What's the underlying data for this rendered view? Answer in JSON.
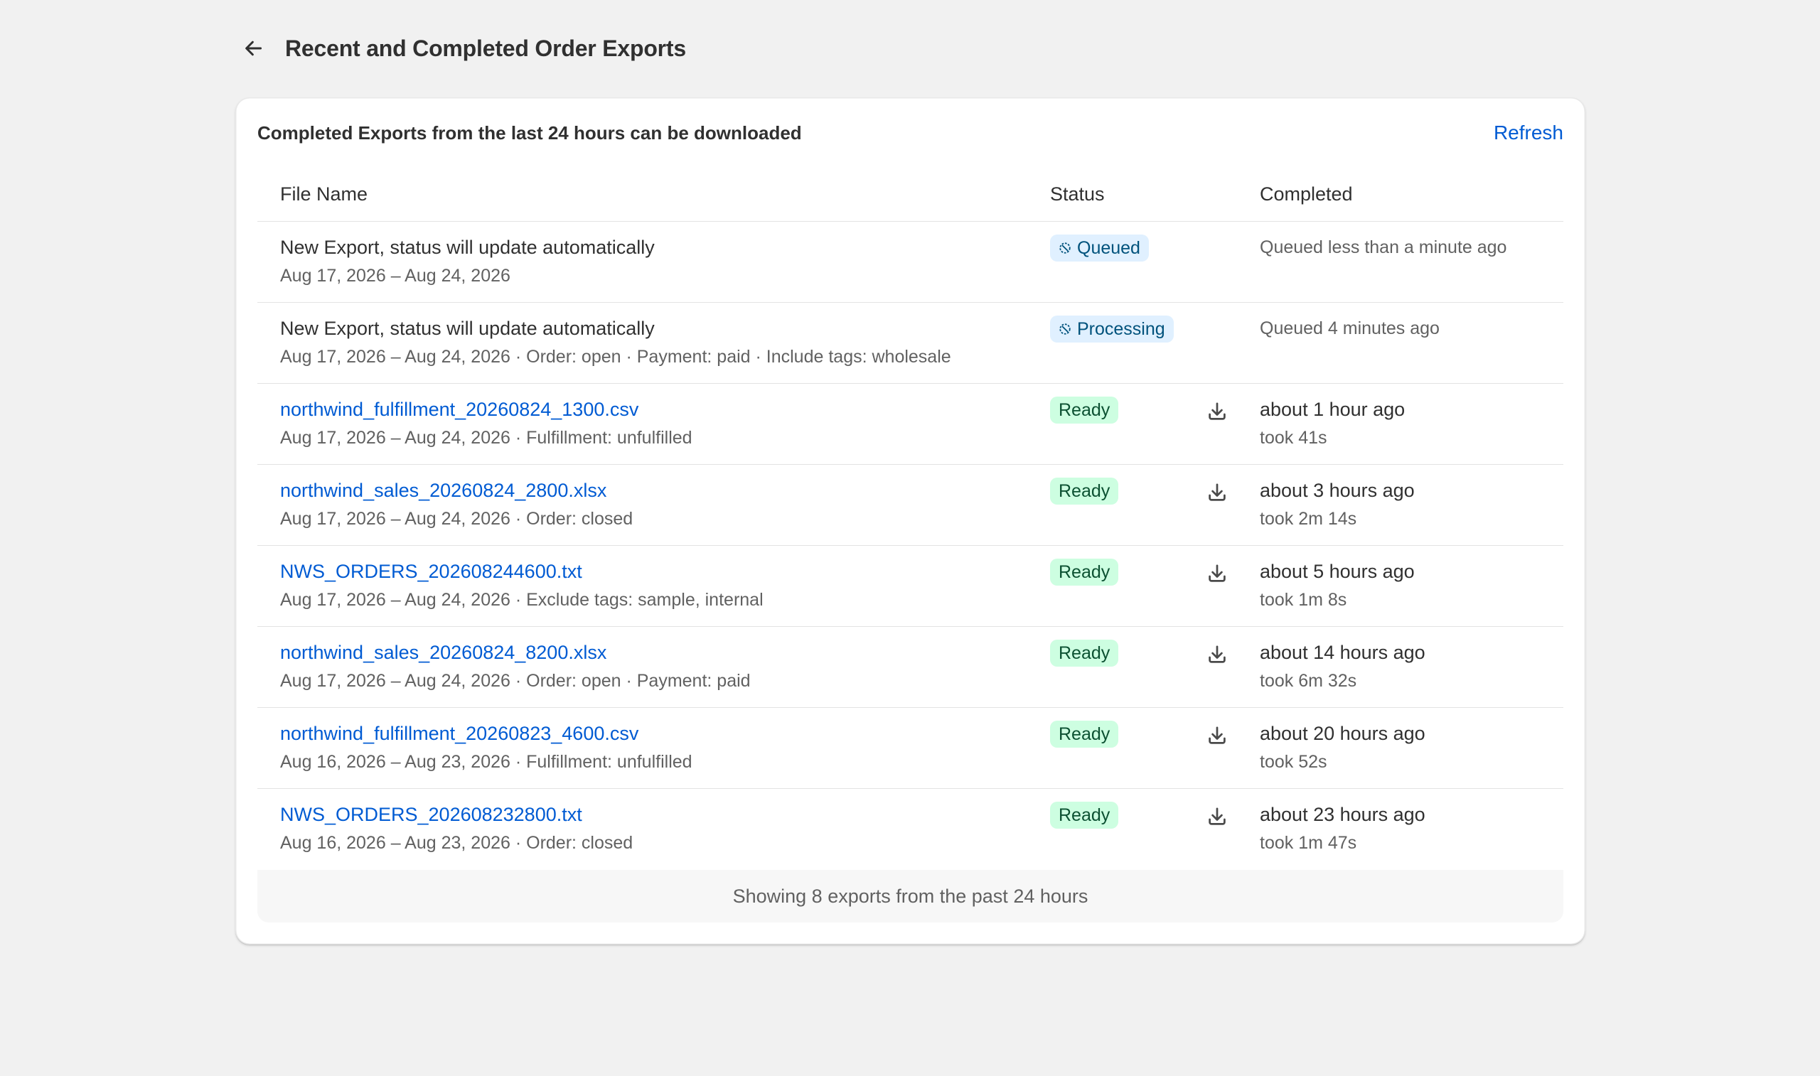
{
  "header": {
    "title": "Recent and Completed Order Exports"
  },
  "card": {
    "title": "Completed Exports from the last 24 hours can be downloaded",
    "refresh_label": "Refresh"
  },
  "table": {
    "columns": {
      "file_name": "File Name",
      "status": "Status",
      "completed": "Completed"
    },
    "rows": [
      {
        "title": "New Export, status will update automatically",
        "subtitle": "Aug 17, 2026 – Aug 24, 2026",
        "status": "Queued",
        "completed": "Queued less than a minute ago",
        "duration": ""
      },
      {
        "title": "New Export, status will update automatically",
        "subtitle": "Aug 17, 2026 – Aug 24, 2026 · Order: open · Payment: paid · Include tags: wholesale",
        "status": "Processing",
        "completed": "Queued 4 minutes ago",
        "duration": ""
      },
      {
        "title": "northwind_fulfillment_20260824_1300.csv",
        "subtitle": "Aug 17, 2026 – Aug 24, 2026 · Fulfillment: unfulfilled",
        "status": "Ready",
        "completed": "about 1 hour ago",
        "duration": "took 41s"
      },
      {
        "title": "northwind_sales_20260824_2800.xlsx",
        "subtitle": "Aug 17, 2026 – Aug 24, 2026 · Order: closed",
        "status": "Ready",
        "completed": "about 3 hours ago",
        "duration": "took 2m 14s"
      },
      {
        "title": "NWS_ORDERS_202608244600.txt",
        "subtitle": "Aug 17, 2026 – Aug 24, 2026 · Exclude tags: sample, internal",
        "status": "Ready",
        "completed": "about 5 hours ago",
        "duration": "took 1m 8s"
      },
      {
        "title": "northwind_sales_20260824_8200.xlsx",
        "subtitle": "Aug 17, 2026 – Aug 24, 2026 · Order: open · Payment: paid",
        "status": "Ready",
        "completed": "about 14 hours ago",
        "duration": "took 6m 32s"
      },
      {
        "title": "northwind_fulfillment_20260823_4600.csv",
        "subtitle": "Aug 16, 2026 – Aug 23, 2026 · Fulfillment: unfulfilled",
        "status": "Ready",
        "completed": "about 20 hours ago",
        "duration": "took 52s"
      },
      {
        "title": "NWS_ORDERS_202608232800.txt",
        "subtitle": "Aug 16, 2026 – Aug 23, 2026 · Order: closed",
        "status": "Ready",
        "completed": "about 23 hours ago",
        "duration": "took 1m 47s"
      }
    ]
  },
  "footer": {
    "text": "Showing 8 exports from the past 24 hours"
  },
  "icons": {
    "back": "arrow-left-icon",
    "pending": "pending-circle-icon",
    "download": "download-icon"
  },
  "colors": {
    "link": "#005bd3",
    "info_badge_bg": "#e0f0ff",
    "info_badge_text": "#00527c",
    "success_badge_bg": "#cdfee1",
    "success_badge_text": "#0c5132",
    "page_bg": "#f1f1f1"
  }
}
